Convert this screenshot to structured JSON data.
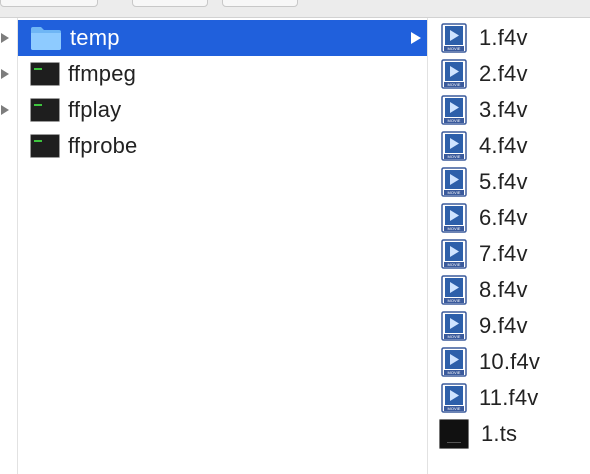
{
  "toolbar": {
    "buttons": [
      "",
      "",
      ""
    ]
  },
  "left_column": {
    "arrows": [
      "disclosure-arrow",
      "disclosure-arrow",
      "disclosure-arrow"
    ]
  },
  "middle_column": {
    "items": [
      {
        "label": "temp",
        "type": "folder",
        "selected": true,
        "has_children": true
      },
      {
        "label": "ffmpeg",
        "type": "unix-executable",
        "selected": false
      },
      {
        "label": "ffplay",
        "type": "unix-executable",
        "selected": false
      },
      {
        "label": "ffprobe",
        "type": "unix-executable",
        "selected": false
      }
    ]
  },
  "right_column": {
    "items": [
      {
        "label": "1.f4v",
        "type": "movie"
      },
      {
        "label": "2.f4v",
        "type": "movie"
      },
      {
        "label": "3.f4v",
        "type": "movie"
      },
      {
        "label": "4.f4v",
        "type": "movie"
      },
      {
        "label": "5.f4v",
        "type": "movie"
      },
      {
        "label": "6.f4v",
        "type": "movie"
      },
      {
        "label": "7.f4v",
        "type": "movie"
      },
      {
        "label": "8.f4v",
        "type": "movie"
      },
      {
        "label": "9.f4v",
        "type": "movie"
      },
      {
        "label": "10.f4v",
        "type": "movie"
      },
      {
        "label": "11.f4v",
        "type": "movie"
      },
      {
        "label": "1.ts",
        "type": "ts-video"
      }
    ],
    "movie_badge": "MOVIE"
  },
  "colors": {
    "selection": "#2060dc",
    "folder": "#6fb6f5",
    "exec_bg": "#1e1e1e",
    "exec_text": "#3ec43e",
    "movie_frame": "#3a5a9c"
  }
}
